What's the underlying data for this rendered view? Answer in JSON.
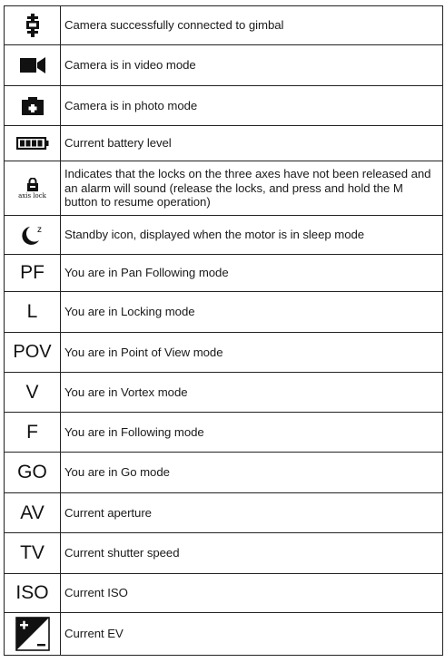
{
  "rows": [
    {
      "icon": "gimbal-connected-icon",
      "description": "Camera successfully connected to gimbal"
    },
    {
      "icon": "video-camera-icon",
      "description": "Camera is in video mode"
    },
    {
      "icon": "photo-camera-icon",
      "description": "Camera is in photo mode"
    },
    {
      "icon": "battery-icon",
      "description": "Current battery level"
    },
    {
      "icon": "axis-lock-icon",
      "icon_text": "axis lock",
      "description": "Indicates that the locks on the three axes have not been released and an alarm will sound (release the locks, and press and hold the M button to resume operation)"
    },
    {
      "icon": "standby-moon-icon",
      "icon_text": "z",
      "description": "Standby icon, displayed when the motor is in sleep mode"
    },
    {
      "abbr": "PF",
      "description": "You are in Pan Following mode"
    },
    {
      "abbr": "L",
      "description": "You are in Locking mode"
    },
    {
      "abbr": "POV",
      "description": "You are in Point of View mode"
    },
    {
      "abbr": "V",
      "description": "You are in Vortex mode"
    },
    {
      "abbr": "F",
      "description": "You are in Following mode"
    },
    {
      "abbr": "GO",
      "description": "You are in Go mode"
    },
    {
      "abbr": "AV",
      "description": "Current aperture"
    },
    {
      "abbr": "TV",
      "description": "Current shutter speed"
    },
    {
      "abbr": "ISO",
      "description": "Current ISO"
    },
    {
      "icon": "exposure-value-icon",
      "icon_text": "+/-",
      "description": "Current EV"
    }
  ]
}
